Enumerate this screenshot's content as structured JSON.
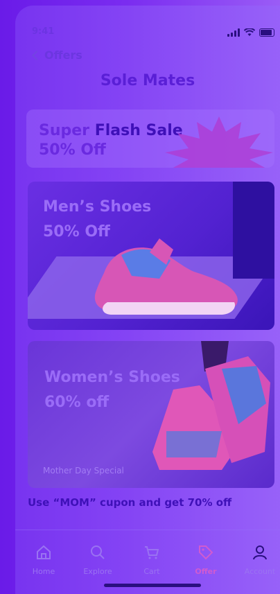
{
  "status": {
    "time": "9:41"
  },
  "header": {
    "back_label": "Offers",
    "title": "Sole Mates"
  },
  "flash": {
    "line1_a": "Super ",
    "line1_b": "Flash Sale",
    "line2": "50% Off"
  },
  "men_card": {
    "title": "Men’s Shoes",
    "discount": "50% Off"
  },
  "women_card": {
    "title": "Women’s Shoes",
    "discount": "60% off",
    "tag": "Mother Day Special"
  },
  "promo": "Use “MOM” cupon and get 70% off",
  "tabs": [
    {
      "label": "Home",
      "icon": "home-icon"
    },
    {
      "label": "Explore",
      "icon": "search-icon"
    },
    {
      "label": "Cart",
      "icon": "cart-icon"
    },
    {
      "label": "Offer",
      "icon": "tag-icon",
      "active": true
    },
    {
      "label": "Account",
      "icon": "user-icon"
    }
  ],
  "colors": {
    "accent": "#5a1fd6",
    "active_tab": "#d05bd0",
    "shoe": "#e05bb8"
  }
}
